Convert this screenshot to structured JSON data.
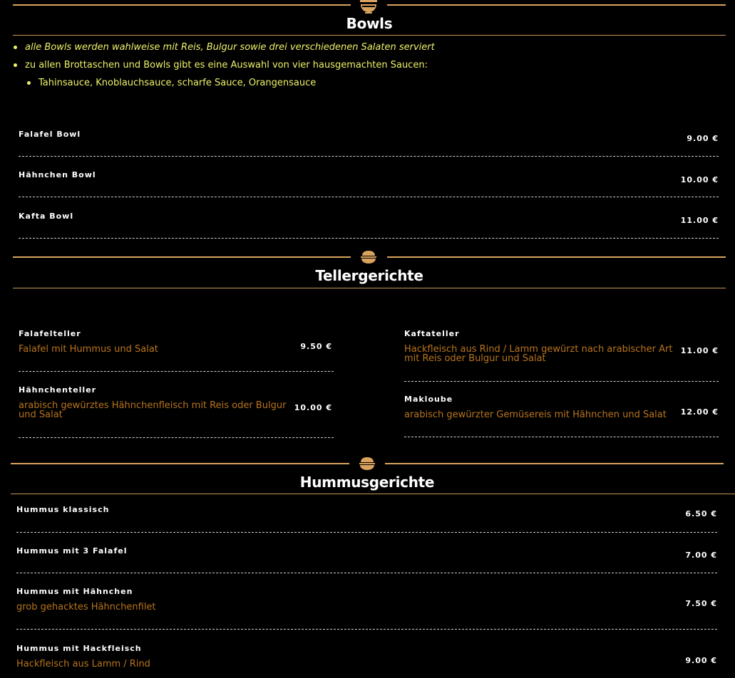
{
  "bowls": {
    "title": "Bowls",
    "notes": [
      "alle Bowls werden wahlweise mit Reis, Bulgur sowie drei verschiedenen Salaten serviert",
      "zu allen Brottaschen und Bowls gibt es eine Auswahl von vier hausgemachten Saucen:",
      "Tahinsauce, Knoblauchsauce, scharfe Sauce, Orangensauce"
    ],
    "items": [
      {
        "name": "Falafel Bowl",
        "price": "9.00 €"
      },
      {
        "name": "Hähnchen Bowl",
        "price": "10.00 €"
      },
      {
        "name": "Kafta Bowl",
        "price": "11.00 €"
      }
    ]
  },
  "tellergerichte": {
    "title": "Tellergerichte",
    "left": [
      {
        "name": "Falafelteller",
        "desc": "Falafel mit Hummus und Salat",
        "price": "9.50 €"
      },
      {
        "name": "Hähnchenteller",
        "desc": "arabisch gewürztes Hähnchenfleisch mit Reis oder Bulgur und Salat",
        "price": "10.00 €"
      }
    ],
    "right": [
      {
        "name": "Kaftateller",
        "desc": "Hackfleisch aus Rind / Lamm gewürzt nach arabischer Art mit Reis oder Bulgur und Salat",
        "price": "11.00 €"
      },
      {
        "name": "Makloube",
        "desc": "arabisch gewürzter Gemüsereis mit Hähnchen und Salat",
        "price": "12.00 €"
      }
    ]
  },
  "hummus": {
    "title": "Hummusgerichte",
    "items": [
      {
        "name": "Hummus klassisch",
        "desc": "",
        "price": "6.50 €"
      },
      {
        "name": "Hummus mit 3 Falafel",
        "desc": "",
        "price": "7.00 €"
      },
      {
        "name": "Hummus mit Hähnchen",
        "desc": "grob gehacktes Hähnchenfilet",
        "price": "7.50 €"
      },
      {
        "name": "Hummus mit Hackfleisch",
        "desc": "Hackfleisch aus Lamm / Rind",
        "price": "9.00 €"
      }
    ]
  },
  "icons": {
    "section": "bowl-icon"
  },
  "colors": {
    "accent": "#d9a35f",
    "note": "#eef16a",
    "description": "#b8741d",
    "background": "#000000"
  }
}
